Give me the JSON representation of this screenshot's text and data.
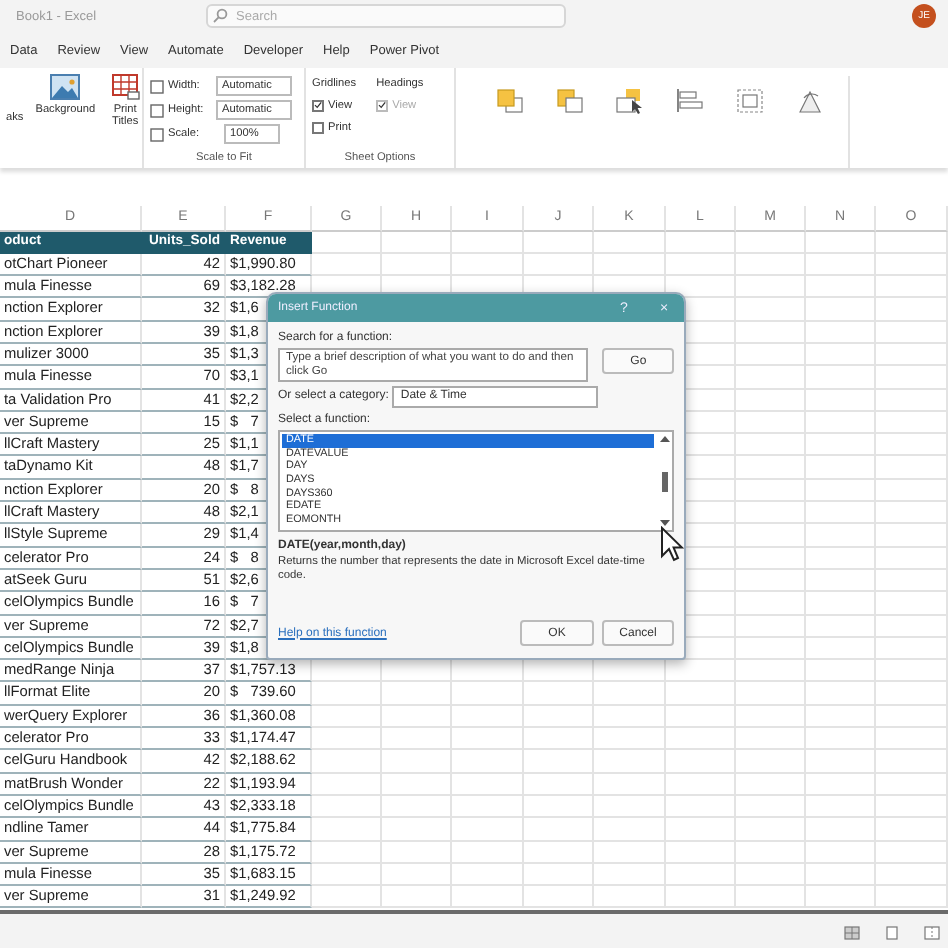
{
  "title_bar": {
    "title": "Book1 - Excel",
    "search": {
      "placeholder": "Search"
    },
    "avatar": "JE"
  },
  "menu": [
    "Data",
    "Review",
    "View",
    "Automate",
    "Developer",
    "Help",
    "Power Pivot"
  ],
  "ribbon": {
    "breaks": "aks",
    "background": "Background",
    "print_titles": "Print Titles",
    "width": {
      "label": "Width:",
      "value": "Automatic"
    },
    "height": {
      "label": "Height:",
      "value": "Automatic"
    },
    "scale": {
      "label": "Scale:",
      "value": "100%"
    },
    "scale_group": "Scale to Fit",
    "gridlines": {
      "title": "Gridlines",
      "view": {
        "label": "View",
        "checked": true
      },
      "print": {
        "label": "Print",
        "checked": false
      }
    },
    "headings": {
      "title": "Headings",
      "view": {
        "label": "View",
        "checked": true
      }
    },
    "sheet_group": "Sheet Options"
  },
  "columns": [
    "D",
    "E",
    "F",
    "G",
    "H",
    "I",
    "J",
    "K",
    "L",
    "M",
    "N",
    "O"
  ],
  "table": {
    "headers": [
      "oduct",
      "Units_Sold",
      "Revenue"
    ],
    "rows": [
      [
        "otChart Pioneer",
        "42",
        "$1,990.80"
      ],
      [
        "mula Finesse",
        "69",
        "$3,182.28"
      ],
      [
        "nction Explorer",
        "32",
        "$1,6"
      ],
      [
        "nction Explorer",
        "39",
        "$1,8"
      ],
      [
        "mulizer 3000",
        "35",
        "$1,3"
      ],
      [
        "mula Finesse",
        "70",
        "$3,1"
      ],
      [
        "ta Validation Pro",
        "41",
        "$2,2"
      ],
      [
        "ver Supreme",
        "15",
        "$   7"
      ],
      [
        "llCraft Mastery",
        "25",
        "$1,1"
      ],
      [
        "taDynamo Kit",
        "48",
        "$1,7"
      ],
      [
        "nction Explorer",
        "20",
        "$   8"
      ],
      [
        "llCraft Mastery",
        "48",
        "$2,1"
      ],
      [
        "llStyle Supreme",
        "29",
        "$1,4"
      ],
      [
        "celerator Pro",
        "24",
        "$   8"
      ],
      [
        "atSeek Guru",
        "51",
        "$2,6"
      ],
      [
        "celOlympics Bundle",
        "16",
        "$   7"
      ],
      [
        "ver Supreme",
        "72",
        "$2,7"
      ],
      [
        "celOlympics Bundle",
        "39",
        "$1,8"
      ],
      [
        "medRange Ninja",
        "37",
        "$1,757.13"
      ],
      [
        "llFormat Elite",
        "20",
        "$   739.60"
      ],
      [
        "werQuery Explorer",
        "36",
        "$1,360.08"
      ],
      [
        "celerator Pro",
        "33",
        "$1,174.47"
      ],
      [
        "celGuru Handbook",
        "42",
        "$2,188.62"
      ],
      [
        "matBrush Wonder",
        "22",
        "$1,193.94"
      ],
      [
        "celOlympics Bundle",
        "43",
        "$2,333.18"
      ],
      [
        "ndline Tamer",
        "44",
        "$1,775.84"
      ],
      [
        "ver Supreme",
        "28",
        "$1,175.72"
      ],
      [
        "mula Finesse",
        "35",
        "$1,683.15"
      ],
      [
        "ver Supreme",
        "31",
        "$1,249.92"
      ]
    ]
  },
  "dialog": {
    "title": "Insert Function",
    "help": "?",
    "close": "×",
    "search_label": "Search for a function:",
    "search_value": "Type a brief description of what you want to do and then click Go",
    "go": "Go",
    "category_label": "Or select a category:",
    "category": "Date & Time",
    "function_label": "Select a function:",
    "functions": [
      {
        "name": "DATE",
        "selected": true
      },
      {
        "name": "DATEVALUE",
        "selected": false
      },
      {
        "name": "DAY",
        "selected": false
      },
      {
        "name": "DAYS",
        "selected": false
      },
      {
        "name": "DAYS360",
        "selected": false
      },
      {
        "name": "EDATE",
        "selected": false
      },
      {
        "name": "EOMONTH",
        "selected": false
      }
    ],
    "signature": "DATE(year,month,day)",
    "description": "Returns the number that represents the date in Microsoft Excel date-time code.",
    "help_link": "Help on this function",
    "ok": "OK",
    "cancel": "Cancel"
  }
}
